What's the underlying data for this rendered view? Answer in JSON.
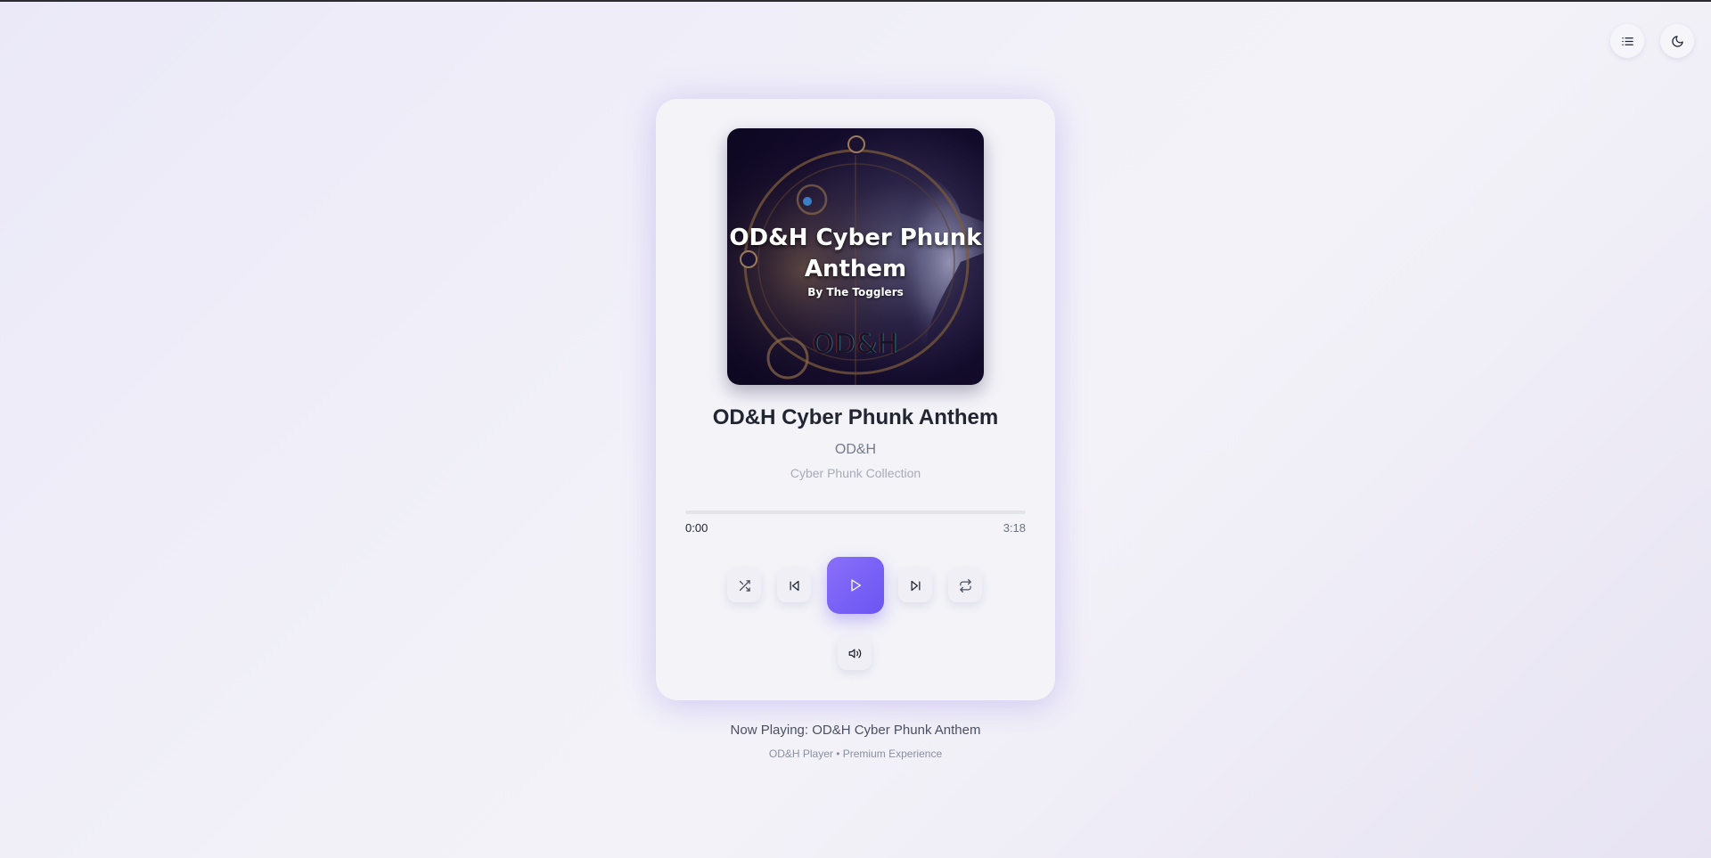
{
  "header": {
    "playlist_icon": "list-icon",
    "theme_icon": "moon-icon"
  },
  "cover": {
    "title": "OD&H Cyber Phunk Anthem",
    "subtitle": "By The Togglers",
    "mark": "OD&H"
  },
  "track": {
    "title": "OD&H Cyber Phunk Anthem",
    "artist": "OD&H",
    "album": "Cyber Phunk Collection"
  },
  "progress": {
    "current_time": "0:00",
    "total_time": "3:18",
    "fraction": 0
  },
  "controls": {
    "shuffle_icon": "shuffle-icon",
    "previous_icon": "skip-back-icon",
    "play_icon": "play-icon",
    "next_icon": "skip-forward-icon",
    "repeat_icon": "repeat-icon",
    "volume_icon": "volume-icon"
  },
  "footer": {
    "now_playing": "Now Playing: OD&H Cyber Phunk Anthem",
    "tagline": "OD&H Player • Premium Experience"
  },
  "colors": {
    "accent": "#7c66f6",
    "card_background": "#f3f3f8"
  }
}
